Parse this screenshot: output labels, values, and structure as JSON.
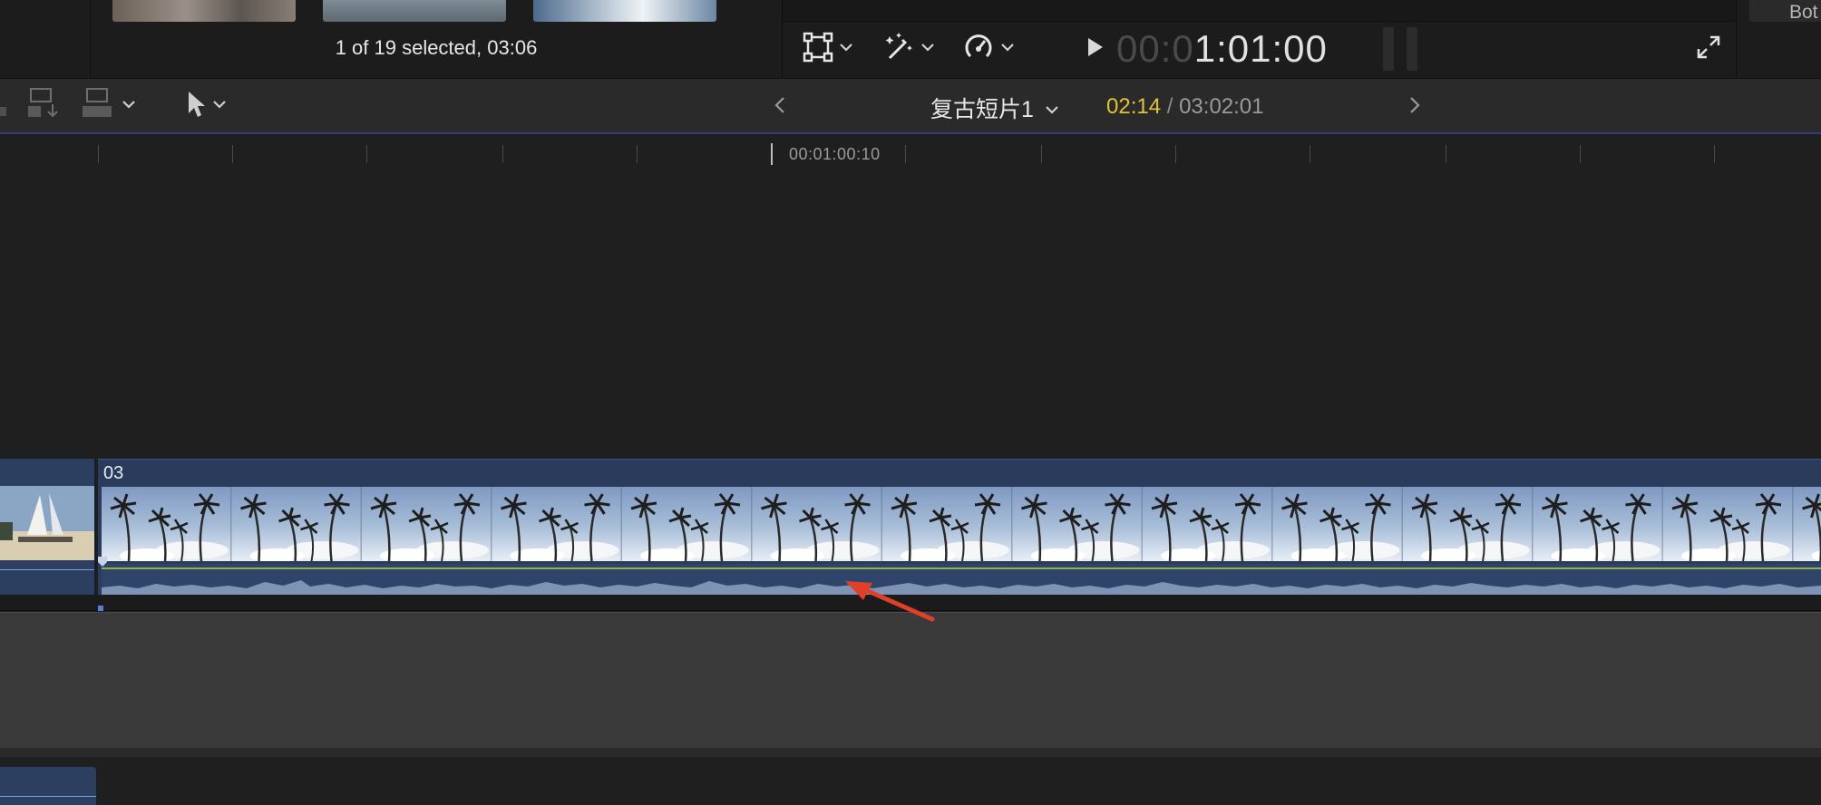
{
  "browser": {
    "selection_info": "1 of 19 selected, 03:06"
  },
  "viewer": {
    "icons": [
      "transform-icon",
      "magic-wand-icon",
      "speed-icon"
    ],
    "timecode_dim": "00:0",
    "timecode_bright": "1:01:00"
  },
  "right_panel": {
    "label": "Bot"
  },
  "timeline": {
    "project_name": "复古短片1",
    "current_time": "02:14",
    "separator": "/",
    "duration": "03:02:01",
    "ruler_label": "00:01:00:10",
    "clip_name": "03"
  },
  "colors": {
    "accent_yellow": "#e3c33a",
    "clip_blue": "#2b3b5c",
    "audio_wave": "#7e93b6",
    "annotation_red": "#e0402a"
  }
}
